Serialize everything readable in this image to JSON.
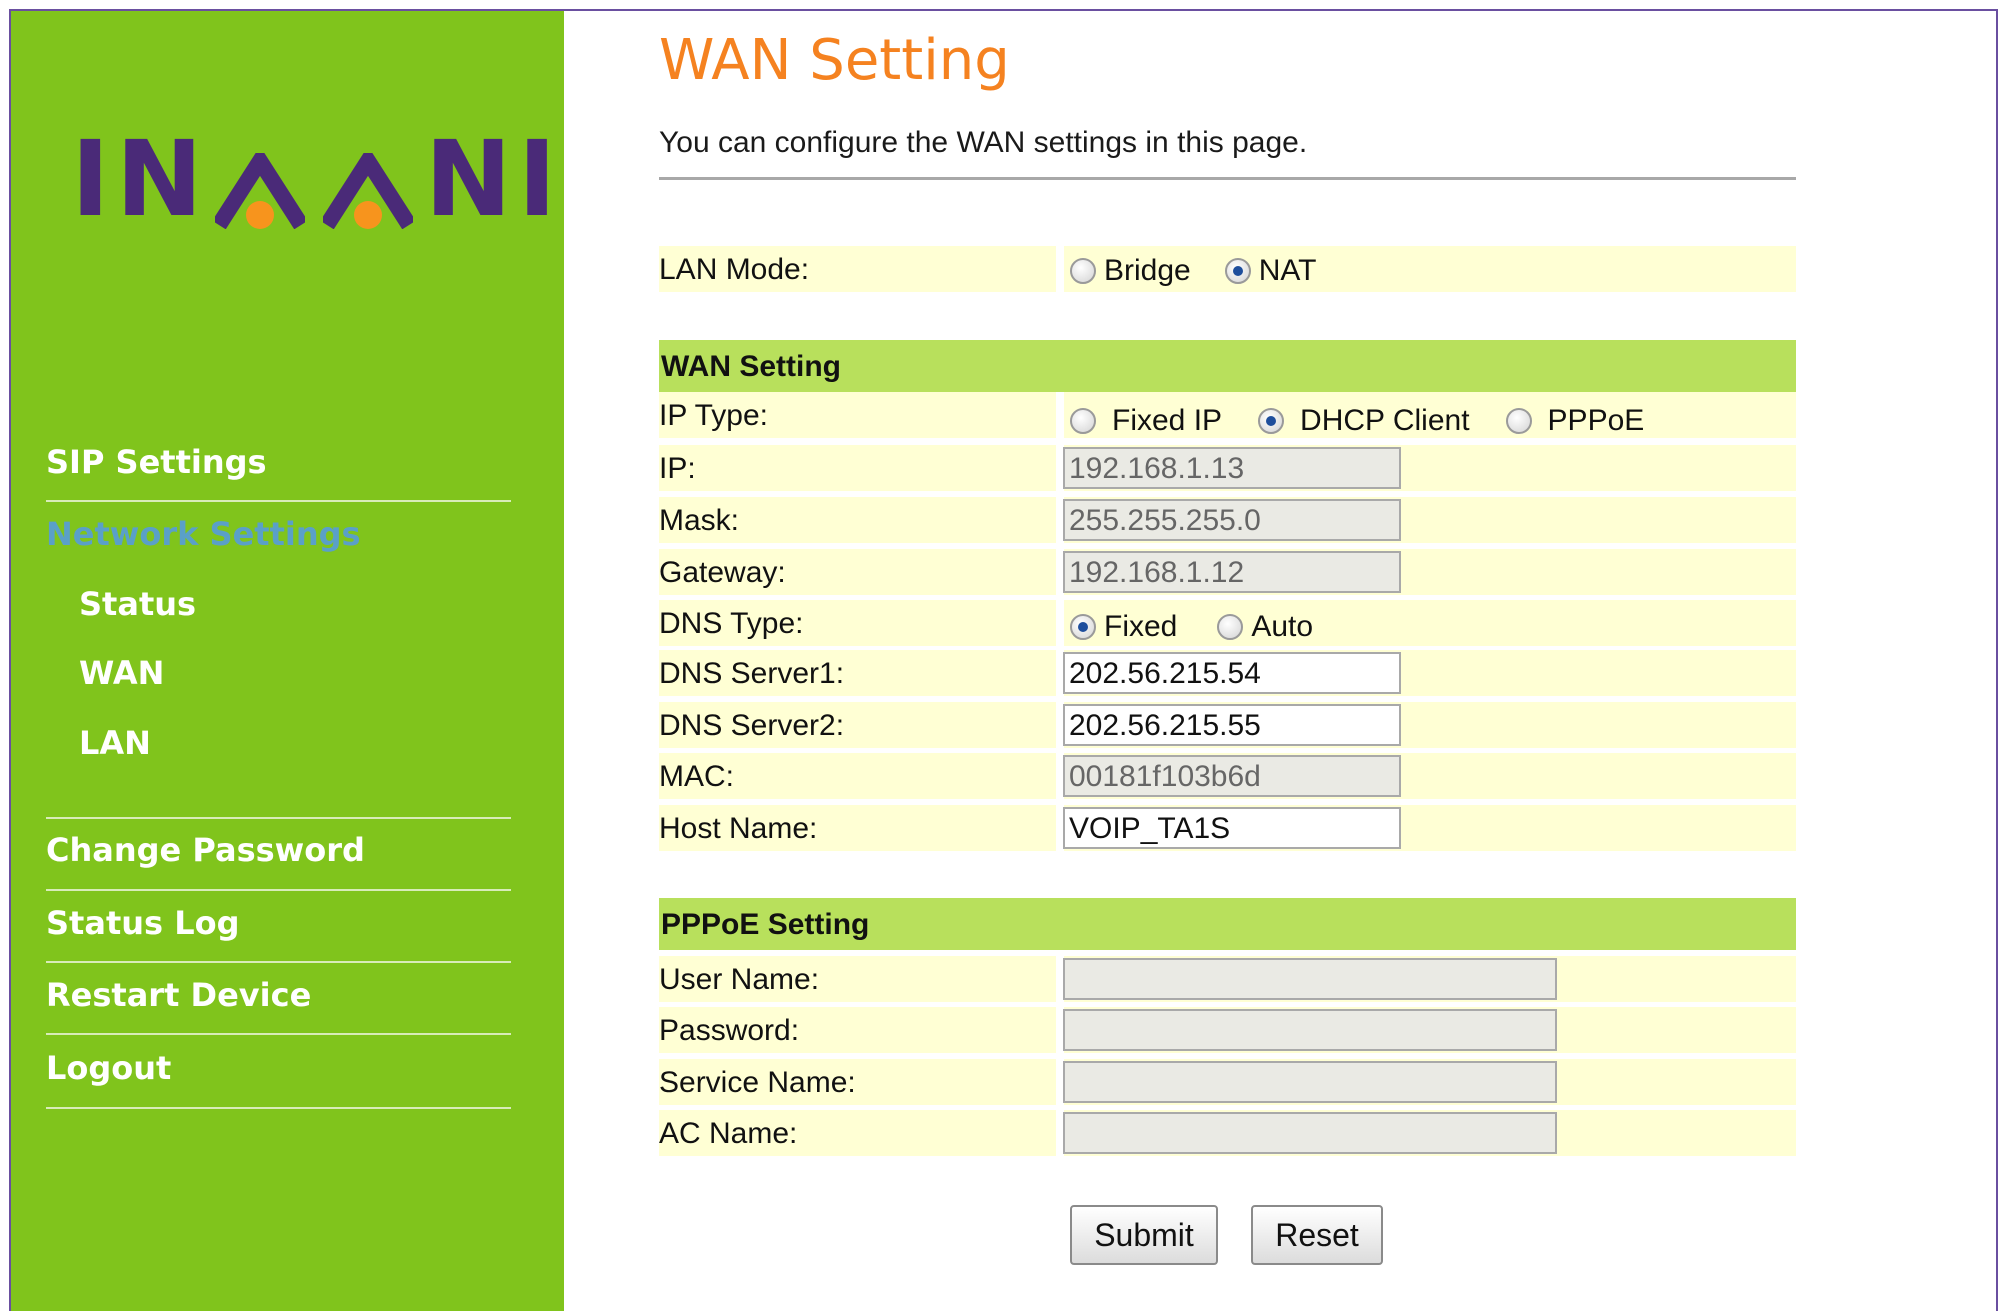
{
  "brand": {
    "logo_text": "INAANI"
  },
  "sidebar": {
    "items": [
      {
        "label": "SIP Settings"
      },
      {
        "label": "Network Settings"
      },
      {
        "label": "Status"
      },
      {
        "label": "WAN"
      },
      {
        "label": "LAN"
      },
      {
        "label": "Change Password"
      },
      {
        "label": "Status Log"
      },
      {
        "label": "Restart Device"
      },
      {
        "label": "Logout"
      }
    ],
    "active_item": "Network Settings"
  },
  "page": {
    "title": "WAN Setting",
    "description": "You can configure the WAN settings in this page."
  },
  "lan_mode": {
    "label": "LAN Mode:",
    "options": [
      "Bridge",
      "NAT"
    ],
    "selected": "NAT"
  },
  "wan": {
    "section_title": "WAN Setting",
    "ip_type": {
      "label": "IP Type:",
      "options": [
        "Fixed IP",
        "DHCP Client",
        "PPPoE"
      ],
      "selected": "DHCP Client"
    },
    "ip": {
      "label": "IP:",
      "value": "192.168.1.13"
    },
    "mask": {
      "label": "Mask:",
      "value": "255.255.255.0"
    },
    "gateway": {
      "label": "Gateway:",
      "value": "192.168.1.12"
    },
    "dns_type": {
      "label": "DNS Type:",
      "options": [
        "Fixed",
        "Auto"
      ],
      "selected": "Fixed"
    },
    "dns1": {
      "label": "DNS Server1:",
      "value": "202.56.215.54"
    },
    "dns2": {
      "label": "DNS Server2:",
      "value": "202.56.215.55"
    },
    "mac": {
      "label": "MAC:",
      "value": "00181f103b6d"
    },
    "host": {
      "label": "Host Name:",
      "value": "VOIP_TA1S"
    }
  },
  "pppoe": {
    "section_title": "PPPoE Setting",
    "user": {
      "label": "User Name:",
      "value": ""
    },
    "password": {
      "label": "Password:",
      "value": ""
    },
    "service": {
      "label": "Service Name:",
      "value": ""
    },
    "ac": {
      "label": "AC Name:",
      "value": ""
    }
  },
  "buttons": {
    "submit": "Submit",
    "reset": "Reset"
  },
  "colors": {
    "sidebar_bg": "#80c41c",
    "title": "#f58220",
    "logo": "#4a2a78",
    "section_bg": "#b8e05c",
    "row_bg": "#ffffd4"
  }
}
